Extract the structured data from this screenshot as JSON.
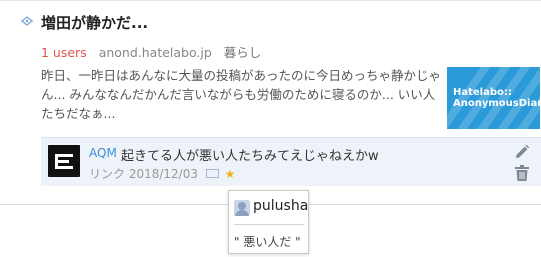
{
  "entry": {
    "title": "増田が静かだ...",
    "users": "1 users",
    "domain": "anond.hatelabo.jp",
    "category": "暮らし",
    "summary": "昨日、一昨日はあんなに大量の投稿があったのに今日めっちゃ静かじゃん... みんななんだかんだ言いながらも労働のために寝るのか... いい人たちだなぁ...",
    "thumbnail_text": "Hatelabo::\nAnonymousDiary"
  },
  "comment": {
    "user": "AQM",
    "text": "起きてる人が悪い人たちみてえじゃねえかw",
    "meta": "リンク 2018/12/03",
    "star": "★"
  },
  "tooltip": {
    "user": "pulusha",
    "quote": "\" 悪い人だ \""
  },
  "colors": {
    "users": "#e0524a",
    "link": "#3e8fd9",
    "star": "#f2b01e",
    "thumb": "#2a9ad8"
  }
}
